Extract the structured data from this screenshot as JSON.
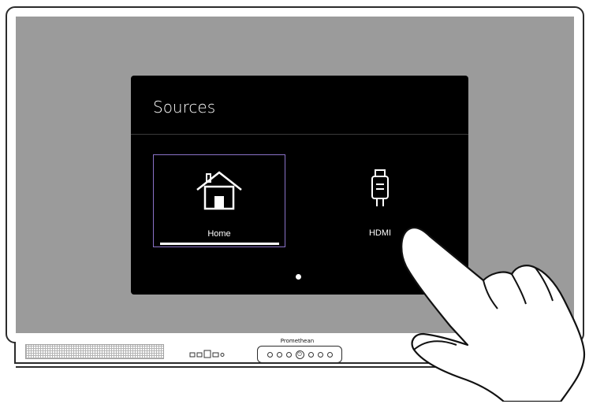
{
  "device": {
    "brand": "Promethean"
  },
  "dialog": {
    "title": "Sources",
    "tiles": [
      {
        "label": "Home",
        "icon": "home-icon",
        "selected": true,
        "progress": 1.0
      },
      {
        "label": "HDMI",
        "icon": "hdmi-icon",
        "selected": false
      }
    ],
    "page_indicator": {
      "current": 1,
      "total": 1
    }
  },
  "colors": {
    "screen": "#9b9b9b",
    "dialog_bg": "#000000",
    "selection_border": "#8a72c8"
  }
}
